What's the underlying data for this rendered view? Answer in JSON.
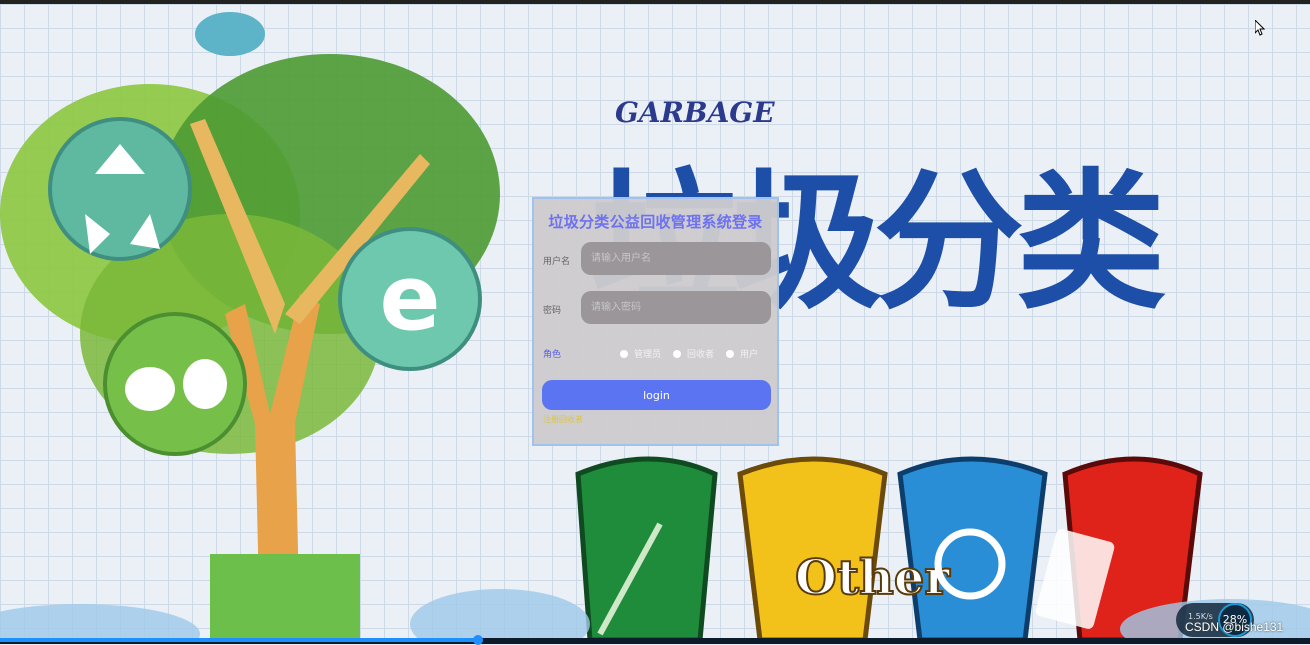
{
  "title": "垃圾分类公益回收管理系统登录",
  "form": {
    "username_label": "用户名",
    "username_placeholder": "请输入用户名",
    "password_label": "密码",
    "password_placeholder": "请输入密码",
    "role_label": "角色",
    "roles": [
      "管理员",
      "回收者",
      "用户"
    ],
    "login_label": "login",
    "register_label": "注册回收者"
  },
  "background": {
    "logo_word": "GARBAGE",
    "logo_title": "垃圾分类",
    "bin_word": "Other"
  },
  "overlay": {
    "watermark": "CSDN @bishe131",
    "net_speed": "1.5K/s",
    "net_percent": "28%"
  },
  "video_progress_fraction": 0.365,
  "colors": {
    "title": "#6e71f0",
    "login_button": "#5b75f2",
    "panel_border": "#9fc3ee"
  }
}
